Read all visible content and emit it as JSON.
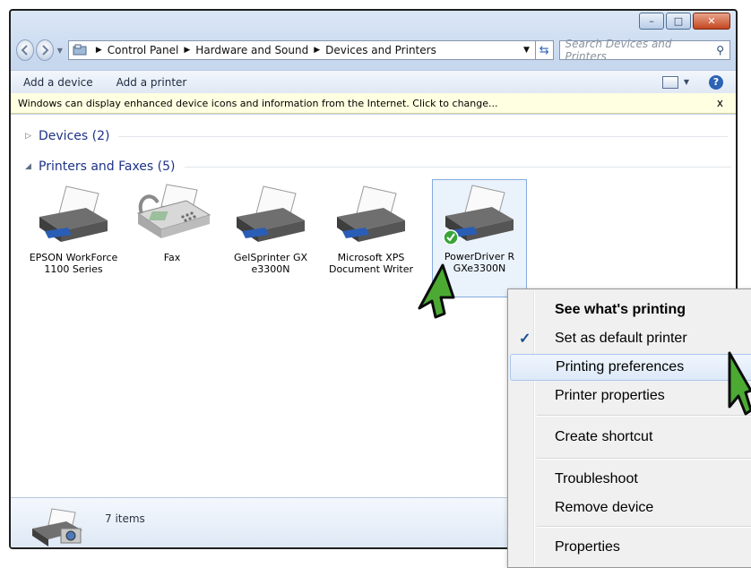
{
  "window": {
    "caption_buttons": {
      "minimize": "–",
      "maximize": "□",
      "close": "✕"
    }
  },
  "address_bar": {
    "back_icon": "back-arrow-icon",
    "forward_icon": "forward-arrow-icon",
    "crumbs": [
      "Control Panel",
      "Hardware and Sound",
      "Devices and Printers"
    ],
    "search_placeholder": "Search Devices and Printers"
  },
  "toolbar": {
    "add_device": "Add a device",
    "add_printer": "Add a printer"
  },
  "infobar": {
    "message": "Windows can display enhanced device icons and information from the Internet. Click to change...",
    "close": "x"
  },
  "groups": {
    "devices": "Devices (2)",
    "printers": "Printers and Faxes (5)"
  },
  "printers": [
    {
      "label": "EPSON WorkForce 1100 Series"
    },
    {
      "label": "Fax"
    },
    {
      "label": "GelSprinter GX e3300N"
    },
    {
      "label": "Microsoft XPS Document Writer"
    },
    {
      "label": "PowerDriver R GXe3300N"
    }
  ],
  "details": {
    "count": "7 items"
  },
  "context_menu": {
    "items": [
      {
        "label": "See what's printing"
      },
      {
        "label": "Set as default printer"
      },
      {
        "label": "Printing preferences"
      },
      {
        "label": "Printer properties"
      },
      {
        "label": "Create shortcut"
      },
      {
        "label": "Troubleshoot"
      },
      {
        "label": "Remove device"
      },
      {
        "label": "Properties"
      }
    ]
  },
  "colors": {
    "accent": "#1e3287",
    "hover": "#dde9f8",
    "cursor": "#4caa33"
  }
}
